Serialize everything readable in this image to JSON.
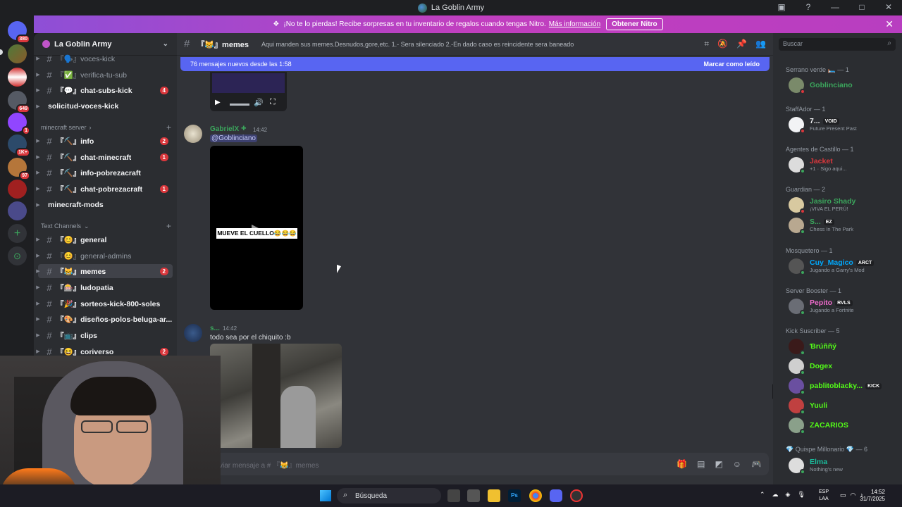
{
  "window": {
    "title": "La Goblin Army"
  },
  "promo": {
    "text": "¡No te lo pierdas! Recibe sorpresas en tu inventario de regalos cuando tengas Nitro.",
    "link": "Más información",
    "button": "Obtener Nitro"
  },
  "guilds": [
    {
      "badge": "380"
    },
    {
      "badge": ""
    },
    {
      "badge": ""
    },
    {
      "badge": "649"
    },
    {
      "badge": "1"
    },
    {
      "badge": "1K+"
    },
    {
      "badge": "97"
    },
    {
      "badge": ""
    },
    {
      "badge": ""
    }
  ],
  "server": {
    "name": "La Goblin Army"
  },
  "channels": [
    {
      "name": "『🗣️』voces-kick",
      "mention": ""
    },
    {
      "name": "『✅』verifica-tu-sub",
      "mention": ""
    },
    {
      "name": "『💬』chat-subs-kick",
      "mention": "4"
    },
    {
      "name": "solicitud-voces-kick",
      "mention": ""
    }
  ],
  "category_minecraft": "minecraft server",
  "minecraft_channels": [
    {
      "name": "『⛏️』info",
      "mention": "2"
    },
    {
      "name": "『⛏️』chat-minecraft",
      "mention": "1"
    },
    {
      "name": "『⛏️』info-pobrezacraft",
      "mention": ""
    },
    {
      "name": "『⛏️』chat-pobrezacraft",
      "mention": "1"
    },
    {
      "name": "minecraft-mods",
      "mention": ""
    }
  ],
  "category_text": "Text Channels",
  "text_channels": [
    {
      "name": "『😊』general",
      "mention": ""
    },
    {
      "name": "『😊』general-admins",
      "mention": ""
    },
    {
      "name": "『😹』memes",
      "mention": "2"
    },
    {
      "name": "『🎰』ludopatia",
      "mention": ""
    },
    {
      "name": "『🎉』sorteos-kick-800-soles",
      "mention": ""
    },
    {
      "name": "『🎨』diseños-polos-beluga-ar...",
      "mention": ""
    },
    {
      "name": "『📺』clips",
      "mention": ""
    },
    {
      "name": "『😆』coriverso",
      "mention": "2"
    }
  ],
  "chat": {
    "channel": "『😹』memes",
    "topic": "Aqui manden sus memes.Desnudos,gore,etc. 1.- Sera silenciado 2.-En dado caso es reincidente sera baneado",
    "new_messages": "76 mensajes nuevos desde las 1:58",
    "mark_read": "Marcar como leído",
    "composer_placeholder": "viar mensaje a # 『😹』memes"
  },
  "messages": [
    {
      "author": "GabrielX",
      "time": "14:42",
      "text": "@Goblinciano",
      "video_caption": "MUEVE EL CUELLO😂😂😂"
    },
    {
      "author": "s...",
      "time": "14:42",
      "text": "todo sea por el chiquito :b"
    }
  ],
  "search_placeholder": "Buscar",
  "members": {
    "groups": [
      {
        "role": "Serrano verde 🛏️ — 1",
        "users": [
          {
            "name": "Goblinciano",
            "status": "",
            "color": "#3ba55c",
            "tag": ""
          }
        ]
      },
      {
        "role": "StaffAdor — 1",
        "users": [
          {
            "name": "7...",
            "status": "Future Present Past",
            "color": "#f2f3f5",
            "tag": "VOID"
          }
        ]
      },
      {
        "role": "Agentes de Castillo — 1",
        "users": [
          {
            "name": "Jacket",
            "status": "+1 · Sigo aqui...",
            "color": "#da373c",
            "tag": ""
          }
        ]
      },
      {
        "role": "Guardian — 2",
        "users": [
          {
            "name": "Jasiro Shady",
            "status": "¡VIVA EL PERÚ!",
            "color": "#3ba55c",
            "tag": ""
          },
          {
            "name": "S...",
            "status": "Chess In The Park",
            "color": "#3ba55c",
            "tag": "EZ"
          }
        ]
      },
      {
        "role": "Mosquetero — 1",
        "users": [
          {
            "name": "Cuy_Magico",
            "status": "Jugando a Garry's Mod",
            "color": "#00a8fc",
            "tag": "ARCT"
          }
        ]
      },
      {
        "role": "Server Booster — 1",
        "users": [
          {
            "name": "Pepito",
            "status": "Jugando a Fortnite",
            "color": "#eb6ac9",
            "tag": "RVLS"
          }
        ]
      },
      {
        "role": "Kick Suscriber — 5",
        "users": [
          {
            "name": "Ɓrúññý",
            "status": "",
            "color": "#53fc18",
            "tag": ""
          },
          {
            "name": "Dogex",
            "status": "",
            "color": "#53fc18",
            "tag": ""
          },
          {
            "name": "pablitoblacky...",
            "status": "",
            "color": "#53fc18",
            "tag": "KICK"
          },
          {
            "name": "Yuuli",
            "status": "",
            "color": "#53fc18",
            "tag": ""
          },
          {
            "name": "ZACARIOS",
            "status": "",
            "color": "#53fc18",
            "tag": ""
          }
        ]
      },
      {
        "role": "💎 Quispe Millonario 💎 — 6",
        "users": [
          {
            "name": "Elma",
            "status": "Nothing's new",
            "color": "#1abc9c",
            "tag": ""
          }
        ]
      }
    ]
  },
  "taskbar": {
    "search": "Búsqueda",
    "lang1": "ESP",
    "lang2": "LAA",
    "time": "14:52",
    "date": "31/7/2025"
  }
}
